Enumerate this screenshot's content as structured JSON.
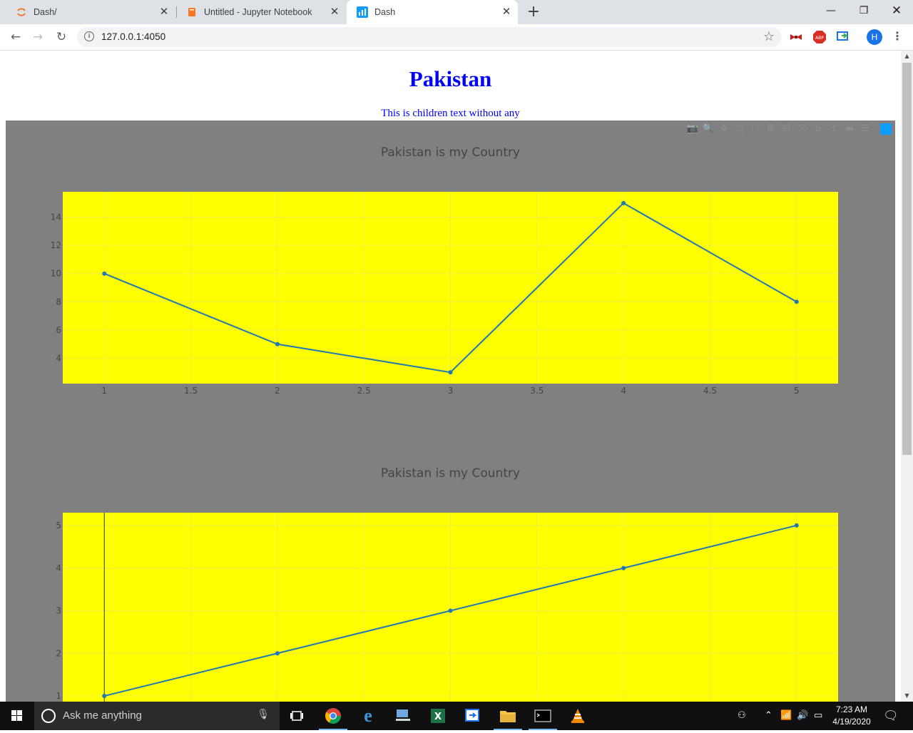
{
  "browser": {
    "tabs": [
      {
        "title": "Dash/",
        "icon": "jupyter-icon",
        "active": false
      },
      {
        "title": "Untitled - Jupyter Notebook",
        "icon": "notebook-icon",
        "active": false
      },
      {
        "title": "Dash",
        "icon": "plotly-dash-icon",
        "active": true
      }
    ],
    "url": "127.0.0.1:4050",
    "profile_initial": "H",
    "window_controls": [
      "minimize-icon",
      "restore-icon",
      "close-icon"
    ]
  },
  "page": {
    "title": "Pakistan",
    "subtitle": "This is children text without any",
    "title_color": "#0000ff",
    "graph_bg_color": "#808080",
    "plot_bg_color": "#ffff00",
    "line_color": "#1f77b4"
  },
  "chart_data": [
    {
      "type": "line",
      "title": "Pakistan is my Country",
      "x": [
        1,
        2,
        3,
        4,
        5
      ],
      "y": [
        10,
        5,
        3,
        15,
        8
      ],
      "xlim": [
        0.76,
        5.24
      ],
      "ylim": [
        2.2,
        15.8
      ],
      "xticks": [
        "1",
        "1.5",
        "2",
        "2.5",
        "3",
        "3.5",
        "4",
        "4.5",
        "5"
      ],
      "yticks": [
        "4",
        "6",
        "8",
        "10",
        "12",
        "14"
      ],
      "mode": "lines+markers",
      "grid": true
    },
    {
      "type": "line",
      "title": "Pakistan is my Country",
      "x": [
        1,
        2,
        3,
        4,
        5
      ],
      "y": [
        1,
        2,
        3,
        4,
        5
      ],
      "xlim": [
        0.76,
        5.24
      ],
      "ylim": [
        0.8,
        5.3
      ],
      "yticks": [
        "1",
        "2",
        "3",
        "4",
        "5"
      ],
      "mode": "lines+markers",
      "grid": true
    }
  ],
  "taskbar": {
    "search_placeholder": "Ask me anything",
    "time": "7:23 AM",
    "date": "4/19/2020"
  }
}
